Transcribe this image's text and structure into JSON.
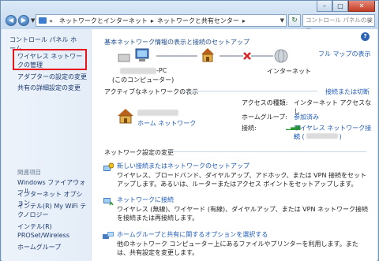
{
  "address": {
    "crumbs": [
      "ネットワークとインターネット",
      "ネットワークと共有センター"
    ]
  },
  "search": {
    "placeholder": "コントロール パネルの検索"
  },
  "sidebar": {
    "home": "コントロール パネル ホーム",
    "items": [
      "ワイヤレス ネットワークの管理",
      "アダプターの設定の変更",
      "共有の詳細設定の変更"
    ],
    "related_title": "関連項目",
    "related": [
      "Windows ファイアウォール",
      "インターネット オプション",
      "インテル(R) My WiFi テクノロジー",
      "インテル(R) PROSet/Wireless",
      "ホームグループ"
    ]
  },
  "main": {
    "heading": "基本ネットワーク情報の表示と接続のセットアップ",
    "full_map": "フル マップの表示",
    "computer_suffix": "-PC",
    "computer_caption": "(このコンピューター)",
    "internet": "インターネット",
    "active_title": "アクティブなネットワークの表示",
    "connect_link": "接続または切断",
    "home_network": "ホーム ネットワーク",
    "access_label": "アクセスの種類:",
    "access_value": "インターネット アクセスなし",
    "homegroup_label": "ホームグループ:",
    "homegroup_value": "参加済み",
    "conn_label": "接続:",
    "conn_value": "ワイヤレス ネットワーク接続",
    "conn_value2": "続 (",
    "conn_value3": ")",
    "settings_title": "ネットワーク設定の変更",
    "tasks": [
      {
        "title": "新しい接続またはネットワークのセットアップ",
        "desc": "ワイヤレス、ブロードバンド、ダイヤルアップ、アドホック、または VPN 接続をセットアップします。あるいは、ルーターまたはアクセス ポイントをセットアップします。"
      },
      {
        "title": "ネットワークに接続",
        "desc": "ワイヤレス (無線)、ワイヤード (有線)、ダイヤルアップ、または VPN ネットワーク接続を接続または再接続します。"
      },
      {
        "title": "ホームグループと共有に関するオプションを選択する",
        "desc": "他のネットワーク コンピューター上にあるファイルやプリンターを利用します。または、共有設定を変更します。"
      }
    ]
  },
  "colors": {
    "highlight": "#e8141c",
    "link": "#1f5bb8"
  }
}
